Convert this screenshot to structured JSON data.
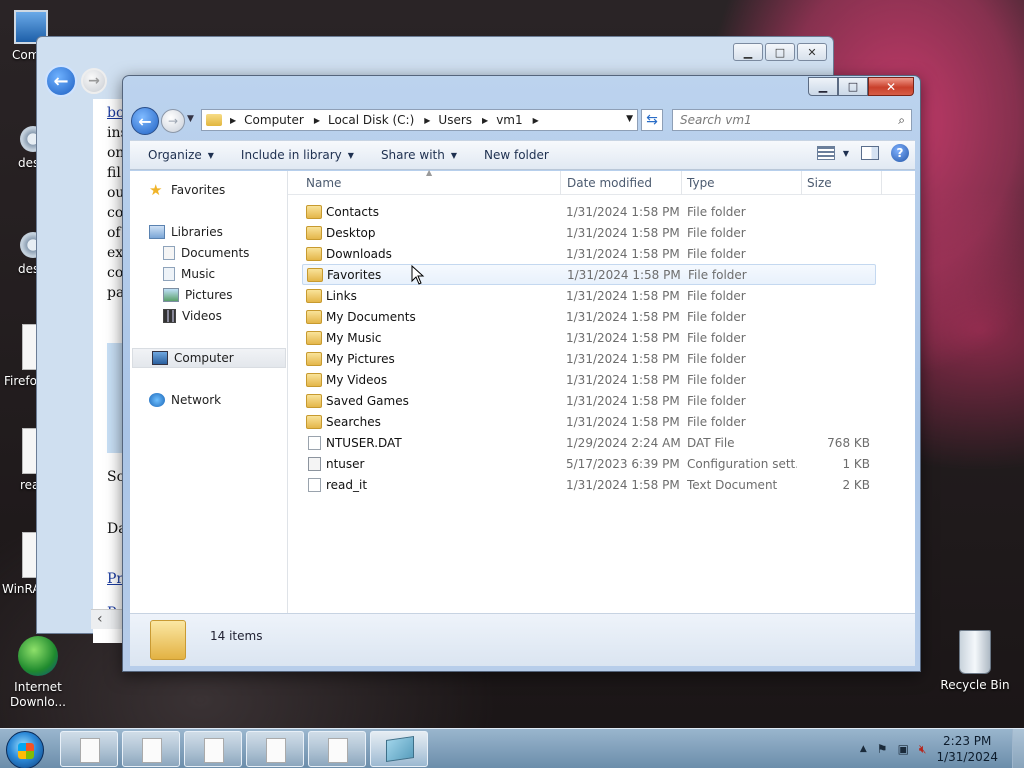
{
  "desktop": {
    "icons": [
      {
        "label": "Com"
      },
      {
        "label": "des"
      },
      {
        "label": "des"
      },
      {
        "label": "Firefo"
      },
      {
        "label": "rea"
      },
      {
        "label": "WinRA"
      },
      {
        "label": "Internet Downlo..."
      },
      {
        "label": "Recycle Bin"
      }
    ]
  },
  "back_window": {
    "page_fragments": [
      "bo",
      "ins",
      "on",
      "fil",
      "ou",
      "co",
      "of",
      "ex",
      "co",
      "pa",
      "So",
      "Da",
      "Pr",
      "Py"
    ]
  },
  "explorer": {
    "address": {
      "crumbs": [
        "Computer",
        "Local Disk (C:)",
        "Users",
        "vm1"
      ]
    },
    "search_placeholder": "Search vm1",
    "toolbar": {
      "organize": "Organize",
      "include": "Include in library",
      "share": "Share with",
      "new_folder": "New folder"
    },
    "nav": {
      "favorites": "Favorites",
      "libraries": "Libraries",
      "documents": "Documents",
      "music": "Music",
      "pictures": "Pictures",
      "videos": "Videos",
      "computer": "Computer",
      "network": "Network"
    },
    "columns": {
      "name": "Name",
      "date": "Date modified",
      "type": "Type",
      "size": "Size"
    },
    "files": [
      {
        "name": "Contacts",
        "date": "1/31/2024 1:58 PM",
        "type": "File folder",
        "size": ""
      },
      {
        "name": "Desktop",
        "date": "1/31/2024 1:58 PM",
        "type": "File folder",
        "size": ""
      },
      {
        "name": "Downloads",
        "date": "1/31/2024 1:58 PM",
        "type": "File folder",
        "size": ""
      },
      {
        "name": "Favorites",
        "date": "1/31/2024 1:58 PM",
        "type": "File folder",
        "size": ""
      },
      {
        "name": "Links",
        "date": "1/31/2024 1:58 PM",
        "type": "File folder",
        "size": ""
      },
      {
        "name": "My Documents",
        "date": "1/31/2024 1:58 PM",
        "type": "File folder",
        "size": ""
      },
      {
        "name": "My Music",
        "date": "1/31/2024 1:58 PM",
        "type": "File folder",
        "size": ""
      },
      {
        "name": "My Pictures",
        "date": "1/31/2024 1:58 PM",
        "type": "File folder",
        "size": ""
      },
      {
        "name": "My Videos",
        "date": "1/31/2024 1:58 PM",
        "type": "File folder",
        "size": ""
      },
      {
        "name": "Saved Games",
        "date": "1/31/2024 1:58 PM",
        "type": "File folder",
        "size": ""
      },
      {
        "name": "Searches",
        "date": "1/31/2024 1:58 PM",
        "type": "File folder",
        "size": ""
      },
      {
        "name": "NTUSER.DAT",
        "date": "1/29/2024 2:24 AM",
        "type": "DAT File",
        "size": "768 KB"
      },
      {
        "name": "ntuser",
        "date": "5/17/2023 6:39 PM",
        "type": "Configuration sett...",
        "size": "1 KB"
      },
      {
        "name": "read_it",
        "date": "1/31/2024 1:58 PM",
        "type": "Text Document",
        "size": "2 KB"
      }
    ],
    "status": {
      "count": "14 items"
    }
  },
  "taskbar": {
    "time": "2:23 PM",
    "date": "1/31/2024"
  }
}
